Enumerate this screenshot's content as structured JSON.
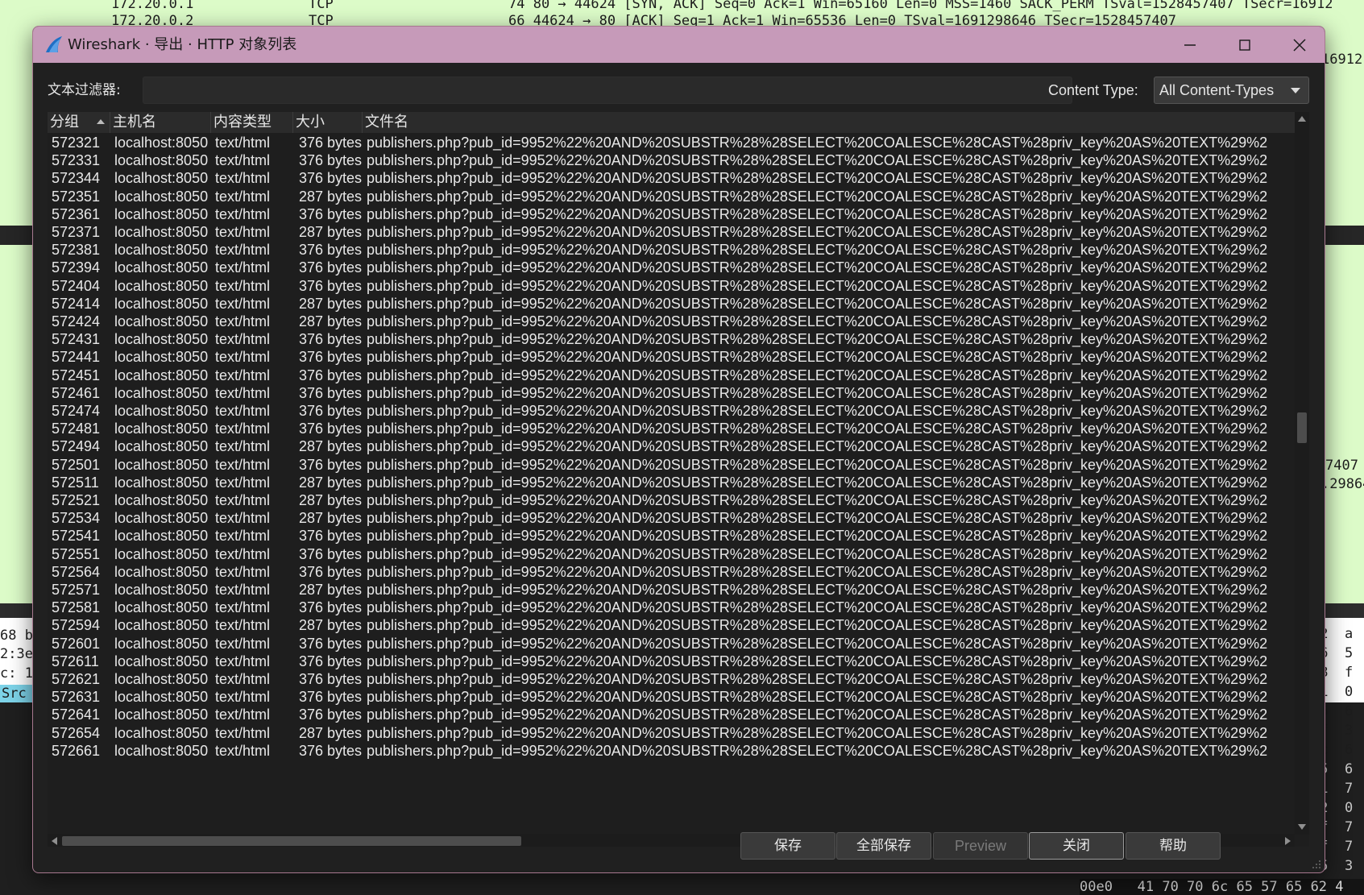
{
  "background": {
    "top_rows": [
      {
        "src": "172.20.0.1",
        "proto": "TCP",
        "info": "74 80 → 44624 [SYN, ACK] Seq=0 Ack=1 Win=65160 Len=0 MSS=1460 SACK_PERM TSval=1528457407 TSecr=16912"
      },
      {
        "src": "172.20.0.2",
        "proto": "TCP",
        "info": "66 44624 → 80 [ACK] Seq=1 Ack=1 Win=65536 Len=0 TSval=1691298646 TSecr=1528457407"
      }
    ],
    "right_fragment_1": "16912",
    "right_fragment_2": "7407",
    "right_fragment_3": ".29864",
    "left_lines": [
      "68 b",
      "2:3e",
      "c: 1"
    ],
    "src_tag": "Src",
    "hex_lines": [
      "42  a",
      "06  5",
      "08  f",
      "01  0",
      "56  6",
      "2f  3",
      "5c  6",
      "35  6",
      "51  7",
      "22  0",
      "5f  7",
      "5f  7",
      "65  3"
    ],
    "hex_bottom": "00e0   41 70 70 6c 65 57 65 62 4"
  },
  "dialog": {
    "title": "Wireshark · 导出 · HTTP 对象列表",
    "filter_label": "文本过滤器:",
    "filter_value": "",
    "content_type_label": "Content Type:",
    "content_type_value": "All Content-Types",
    "columns": [
      "分组",
      "主机名",
      "内容类型",
      "大小",
      "文件名"
    ],
    "filename_prefix": "publishers.php?pub_id=9952%22%20AND%20SUBSTR%28%28SELECT%20COALESCE%28CAST%28priv_key%20AS%20TEXT%29%2",
    "rows": [
      {
        "packet": "572321",
        "host": "localhost:8050",
        "type": "text/html",
        "size": "376 bytes"
      },
      {
        "packet": "572331",
        "host": "localhost:8050",
        "type": "text/html",
        "size": "376 bytes"
      },
      {
        "packet": "572344",
        "host": "localhost:8050",
        "type": "text/html",
        "size": "376 bytes"
      },
      {
        "packet": "572351",
        "host": "localhost:8050",
        "type": "text/html",
        "size": "287 bytes"
      },
      {
        "packet": "572361",
        "host": "localhost:8050",
        "type": "text/html",
        "size": "376 bytes"
      },
      {
        "packet": "572371",
        "host": "localhost:8050",
        "type": "text/html",
        "size": "287 bytes"
      },
      {
        "packet": "572381",
        "host": "localhost:8050",
        "type": "text/html",
        "size": "376 bytes"
      },
      {
        "packet": "572394",
        "host": "localhost:8050",
        "type": "text/html",
        "size": "376 bytes"
      },
      {
        "packet": "572404",
        "host": "localhost:8050",
        "type": "text/html",
        "size": "376 bytes"
      },
      {
        "packet": "572414",
        "host": "localhost:8050",
        "type": "text/html",
        "size": "287 bytes"
      },
      {
        "packet": "572424",
        "host": "localhost:8050",
        "type": "text/html",
        "size": "287 bytes"
      },
      {
        "packet": "572431",
        "host": "localhost:8050",
        "type": "text/html",
        "size": "376 bytes"
      },
      {
        "packet": "572441",
        "host": "localhost:8050",
        "type": "text/html",
        "size": "376 bytes"
      },
      {
        "packet": "572451",
        "host": "localhost:8050",
        "type": "text/html",
        "size": "376 bytes"
      },
      {
        "packet": "572461",
        "host": "localhost:8050",
        "type": "text/html",
        "size": "376 bytes"
      },
      {
        "packet": "572474",
        "host": "localhost:8050",
        "type": "text/html",
        "size": "376 bytes"
      },
      {
        "packet": "572481",
        "host": "localhost:8050",
        "type": "text/html",
        "size": "376 bytes"
      },
      {
        "packet": "572494",
        "host": "localhost:8050",
        "type": "text/html",
        "size": "287 bytes"
      },
      {
        "packet": "572501",
        "host": "localhost:8050",
        "type": "text/html",
        "size": "376 bytes"
      },
      {
        "packet": "572511",
        "host": "localhost:8050",
        "type": "text/html",
        "size": "287 bytes"
      },
      {
        "packet": "572521",
        "host": "localhost:8050",
        "type": "text/html",
        "size": "287 bytes"
      },
      {
        "packet": "572534",
        "host": "localhost:8050",
        "type": "text/html",
        "size": "287 bytes"
      },
      {
        "packet": "572541",
        "host": "localhost:8050",
        "type": "text/html",
        "size": "376 bytes"
      },
      {
        "packet": "572551",
        "host": "localhost:8050",
        "type": "text/html",
        "size": "376 bytes"
      },
      {
        "packet": "572564",
        "host": "localhost:8050",
        "type": "text/html",
        "size": "376 bytes"
      },
      {
        "packet": "572571",
        "host": "localhost:8050",
        "type": "text/html",
        "size": "287 bytes"
      },
      {
        "packet": "572581",
        "host": "localhost:8050",
        "type": "text/html",
        "size": "376 bytes"
      },
      {
        "packet": "572594",
        "host": "localhost:8050",
        "type": "text/html",
        "size": "287 bytes"
      },
      {
        "packet": "572601",
        "host": "localhost:8050",
        "type": "text/html",
        "size": "376 bytes"
      },
      {
        "packet": "572611",
        "host": "localhost:8050",
        "type": "text/html",
        "size": "376 bytes"
      },
      {
        "packet": "572621",
        "host": "localhost:8050",
        "type": "text/html",
        "size": "376 bytes"
      },
      {
        "packet": "572631",
        "host": "localhost:8050",
        "type": "text/html",
        "size": "376 bytes"
      },
      {
        "packet": "572641",
        "host": "localhost:8050",
        "type": "text/html",
        "size": "376 bytes"
      },
      {
        "packet": "572654",
        "host": "localhost:8050",
        "type": "text/html",
        "size": "287 bytes"
      },
      {
        "packet": "572661",
        "host": "localhost:8050",
        "type": "text/html",
        "size": "376 bytes"
      }
    ],
    "buttons": {
      "save": "保存",
      "save_all": "全部保存",
      "preview": "Preview",
      "close": "关闭",
      "help": "帮助"
    },
    "icons": {
      "app": "wireshark-fin-icon",
      "minimize": "minimize-icon",
      "maximize": "maximize-icon",
      "close": "close-icon"
    },
    "colors": {
      "titlebar": "#c69ab9",
      "dialog_bg": "#202020",
      "text": "#e8e8e8",
      "packet_list_bg": "#dcfbc8"
    }
  }
}
